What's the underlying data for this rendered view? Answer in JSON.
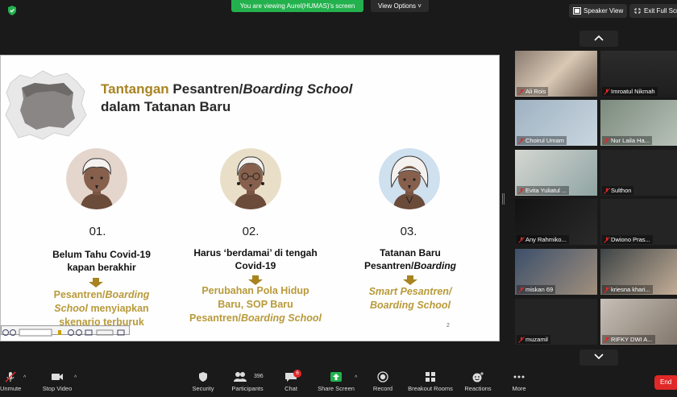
{
  "topbar": {
    "viewing_text": "You are viewing Aurel(HUMAS)'s screen",
    "view_options": "View Options ˅",
    "speaker_view": "Speaker View",
    "exit_full_screen": "Exit Full Scre"
  },
  "slide": {
    "title_part1": "Tantangan ",
    "title_part2": "Pesantren/",
    "title_part3": "Boarding School",
    "title_line2": "dalam Tatanan Baru",
    "items": [
      {
        "number": "01.",
        "desc_line1": "Belum Tahu Covid-19",
        "desc_line2": "kapan berakhir",
        "res_line1a": "Pesantren/",
        "res_line1b": "Boarding",
        "res_line2a": "School",
        "res_line2b": " menyiapkan",
        "res_line3": "skenario terburuk"
      },
      {
        "number": "02.",
        "desc_line1": "Harus ‘berdamai’ di tengah",
        "desc_line2": "Covid-19",
        "res_line1": "Perubahan Pola Hidup",
        "res_line2": "Baru, SOP Baru",
        "res_line3a": "Pesantren/",
        "res_line3b": "Boarding School"
      },
      {
        "number": "03.",
        "desc_line1": "Tatanan Baru",
        "desc_line2a": "Pesantren/",
        "desc_line2b": "Boarding",
        "res_line1": "Smart Pesantren/",
        "res_line2": "Boarding School"
      }
    ],
    "page_number": "2",
    "accent_color": "#a88320",
    "result_color": "#b89a3a"
  },
  "participants": [
    {
      "name": "Ali Rois"
    },
    {
      "name": "Imroatul Nikmah"
    },
    {
      "name": "Choirul Umam"
    },
    {
      "name": "Nur Laila Ha..."
    },
    {
      "name": "Evita Yuliatul ..."
    },
    {
      "name": "Sulthon"
    },
    {
      "name": "Any Rahmiko..."
    },
    {
      "name": "Dwiono Pras..."
    },
    {
      "name": "miskan 69"
    },
    {
      "name": "kriesna khari..."
    },
    {
      "name": "muzamil"
    },
    {
      "name": "RIFKY DWI A..."
    }
  ],
  "toolbar": {
    "unmute": "Unmute",
    "stop_video": "Stop Video",
    "security": "Security",
    "participants": "Participants",
    "participants_count": "396",
    "chat": "Chat",
    "chat_badge": "6",
    "share_screen": "Share Screen",
    "record": "Record",
    "breakout_rooms": "Breakout Rooms",
    "reactions": "Reactions",
    "more": "More",
    "end": "End"
  }
}
